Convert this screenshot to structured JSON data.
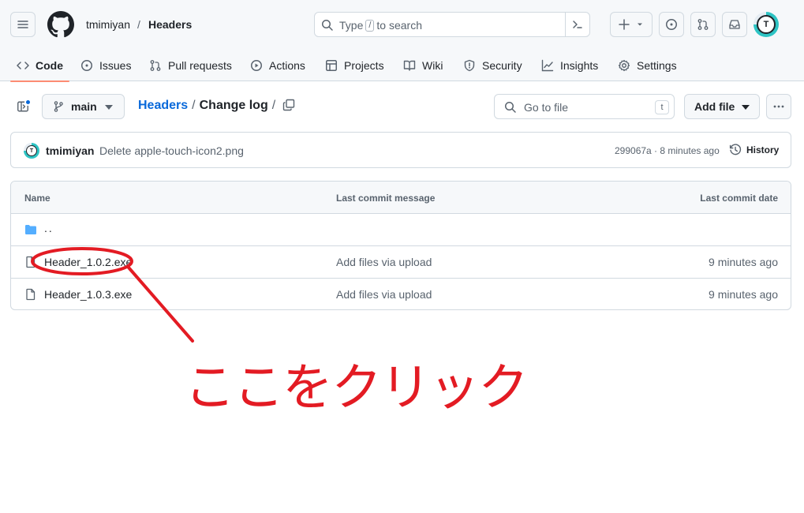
{
  "header": {
    "owner": "tmimiyan",
    "separator": "/",
    "repo": "Headers",
    "search_prefix": "Type",
    "search_key": "/",
    "search_suffix": "to search",
    "avatar_letter": "T"
  },
  "tabs": [
    {
      "label": "Code",
      "icon": "code-icon",
      "active": true
    },
    {
      "label": "Issues",
      "icon": "issue-icon"
    },
    {
      "label": "Pull requests",
      "icon": "pull-request-icon"
    },
    {
      "label": "Actions",
      "icon": "play-icon"
    },
    {
      "label": "Projects",
      "icon": "table-icon"
    },
    {
      "label": "Wiki",
      "icon": "book-icon"
    },
    {
      "label": "Security",
      "icon": "shield-icon"
    },
    {
      "label": "Insights",
      "icon": "graph-icon"
    },
    {
      "label": "Settings",
      "icon": "gear-icon"
    }
  ],
  "toolbar": {
    "branch": "main",
    "path_repo": "Headers",
    "path_sep": "/",
    "path_dir": "Change log",
    "path_trailing": "/",
    "goto_placeholder": "Go to file",
    "goto_key": "t",
    "add_file": "Add file"
  },
  "commit": {
    "user": "tmimiyan",
    "message": "Delete apple-touch-icon2.png",
    "meta": "299067a · 8 minutes ago",
    "history": "History",
    "avatar_letter": "T"
  },
  "table": {
    "headers": {
      "name": "Name",
      "message": "Last commit message",
      "date": "Last commit date"
    },
    "parent_dir": "..",
    "rows": [
      {
        "name": "Header_1.0.2.exe",
        "message": "Add files via upload",
        "date": "9 minutes ago"
      },
      {
        "name": "Header_1.0.3.exe",
        "message": "Add files via upload",
        "date": "9 minutes ago"
      }
    ]
  },
  "annotation": {
    "text": "ここをクリック",
    "color": "#e31b23"
  },
  "colors": {
    "link": "#0969da",
    "active_tab_underline": "#fd8c73",
    "folder": "#54aeff"
  }
}
